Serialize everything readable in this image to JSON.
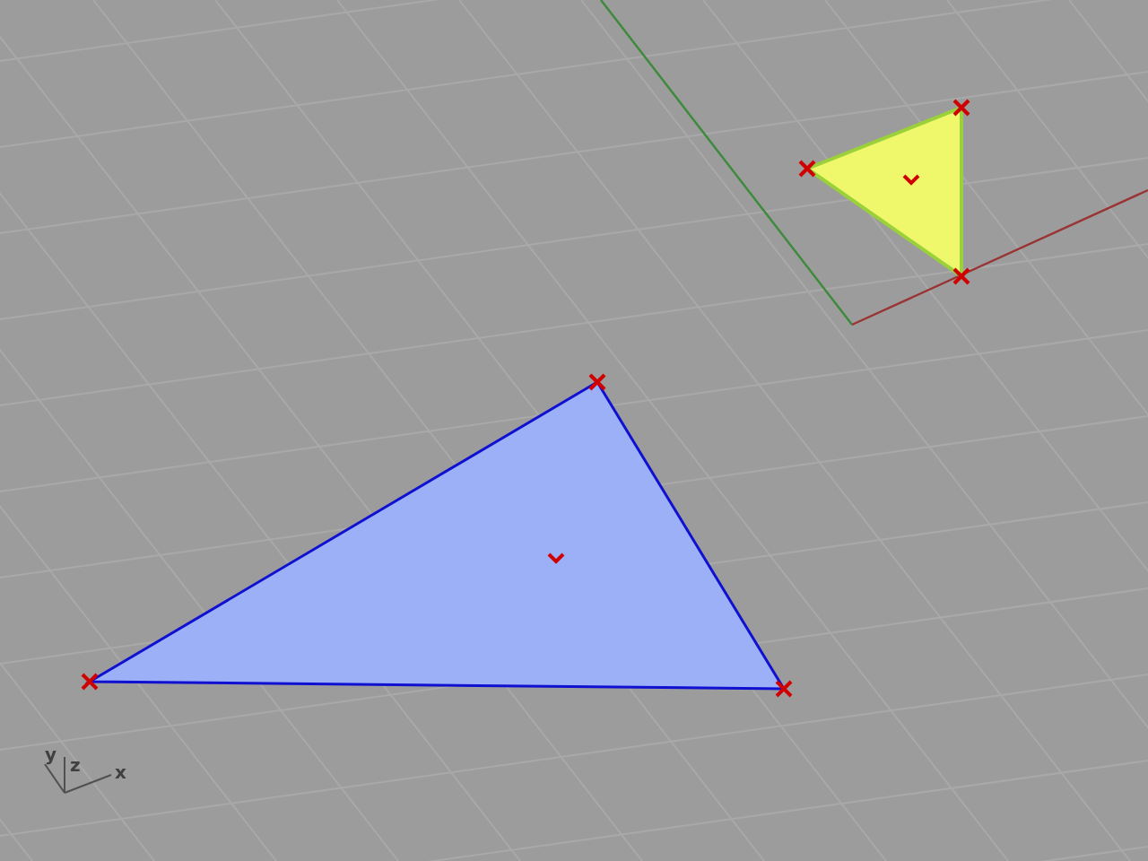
{
  "viewport": {
    "triangles": [
      {
        "color": "#eef86a",
        "selected": true
      },
      {
        "color": "#9cb0f8",
        "selected": false
      }
    ],
    "axis_labels": [
      "y",
      "z",
      "x"
    ]
  }
}
